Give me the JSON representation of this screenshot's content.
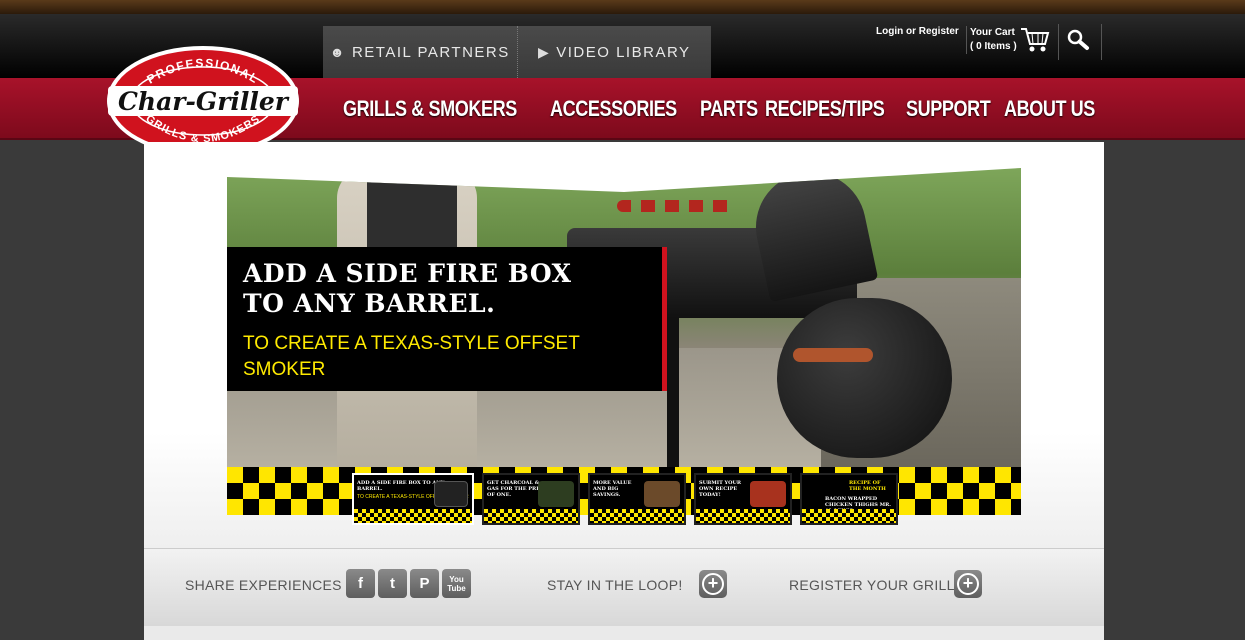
{
  "util_nav": {
    "retail_partners": "RETAIL PARTNERS",
    "video_library": "VIDEO LIBRARY",
    "retail_icon": "users-icon",
    "video_icon": "youtube-icon"
  },
  "account": {
    "login": "Login or Register",
    "cart_label": "Your Cart",
    "cart_items": "( 0 Items )",
    "cart_icon": "cart-icon",
    "search_icon": "search-icon"
  },
  "brand": {
    "top": "PROFESSIONAL",
    "name": "Char-Griller",
    "bottom": "GRILLS & SMOKERS",
    "color": "#d0121e"
  },
  "main_nav": [
    "GRILLS & SMOKERS",
    "ACCESSORIES",
    "PARTS",
    "RECIPES/TIPS",
    "SUPPORT",
    "ABOUT US"
  ],
  "hero": {
    "headline_1": "ADD A SIDE FIRE BOX",
    "headline_2": "TO ANY BARREL.",
    "subhead_1": "TO CREATE A TEXAS-STYLE OFFSET",
    "subhead_2": "SMOKER",
    "accent": "#ffea00"
  },
  "thumbs": [
    {
      "text": "ADD A SIDE FIRE BOX TO ANY BARREL.",
      "sub": "TO CREATE A TEXAS-STYLE OFFSET SMOKER",
      "active": true
    },
    {
      "text": "GET CHARCOAL & GAS FOR THE PRICE OF ONE.",
      "sub": "",
      "active": false
    },
    {
      "text": "MORE VALUE AND BIG SAVINGS.",
      "sub": "",
      "active": false
    },
    {
      "text": "SUBMIT YOUR OWN RECIPE TODAY!",
      "sub": "",
      "active": false
    },
    {
      "text": "RECIPE OF THE MONTH",
      "sub": "BACON WRAPPED CHICKEN THIGHS  MR. AL LEWIS",
      "active": false
    }
  ],
  "footer": {
    "share": "SHARE EXPERIENCES",
    "stay": "STAY IN THE LOOP!",
    "register": "REGISTER YOUR GRILL",
    "social": [
      {
        "glyph": "f",
        "icon": "facebook-icon"
      },
      {
        "glyph": "t",
        "icon": "twitter-icon"
      },
      {
        "glyph": "P",
        "icon": "pinterest-icon"
      },
      {
        "glyph": "You Tube",
        "icon": "youtube-icon"
      }
    ]
  }
}
